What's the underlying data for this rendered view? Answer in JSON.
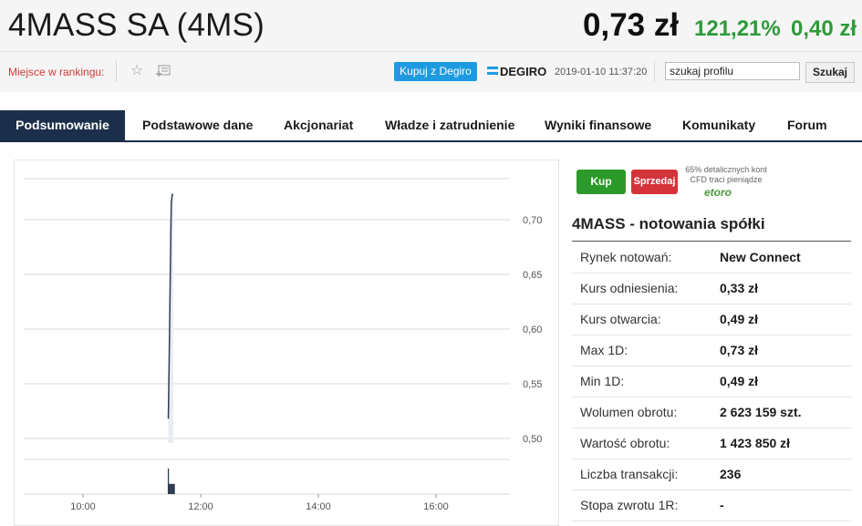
{
  "header": {
    "title": "4MASS SA (4MS)",
    "price": "0,73 zł",
    "change_pct": "121,21%",
    "change_abs": "0,40 zł",
    "rank_label": "Miejsce w rankingu:",
    "buy_degiro": "Kupuj z Degiro",
    "degiro_logo": "DEGIRO",
    "timestamp": "2019-01-10 11:37:20",
    "search_value": "szukaj profilu",
    "search_button": "Szukaj",
    "icons": [
      "star-icon",
      "add-to-list-icon",
      "degiro-logo-icon"
    ]
  },
  "tabs": [
    {
      "label": "Podsumowanie",
      "active": true
    },
    {
      "label": "Podstawowe dane"
    },
    {
      "label": "Akcjonariat"
    },
    {
      "label": "Władze i zatrudnienie"
    },
    {
      "label": "Wyniki finansowe"
    },
    {
      "label": "Komunikaty"
    },
    {
      "label": "Forum"
    }
  ],
  "chart_data": {
    "type": "line",
    "x_ticks": [
      "10:00",
      "12:00",
      "14:00",
      "16:00"
    ],
    "y_ticks": [
      "0,70",
      "0,65",
      "0,60",
      "0,55",
      "0,50"
    ],
    "ylim": [
      0.5,
      0.72
    ],
    "series": [
      {
        "values": [
          {
            "t": "11:27",
            "y": 0.518
          },
          {
            "t": "11:28",
            "y": 0.58
          },
          {
            "t": "11:29",
            "y": 0.65
          },
          {
            "t": "11:30",
            "y": 0.715
          },
          {
            "t": "11:31",
            "y": 0.723
          },
          {
            "t": "11:32",
            "y": 0.723
          }
        ]
      }
    ],
    "volume_bars": [
      {
        "t": "11:27",
        "v": 1.0
      },
      {
        "t": "11:28",
        "v": 0.4
      },
      {
        "t": "11:29",
        "v": 0.4
      },
      {
        "t": "11:30",
        "v": 0.4
      },
      {
        "t": "11:31",
        "v": 0.4
      },
      {
        "t": "11:32",
        "v": 0.4
      },
      {
        "t": "11:33",
        "v": 0.4
      }
    ],
    "colors": {
      "line": "#2f3b52",
      "area": "#e8edf3",
      "grid": "#d9d9d9",
      "volume": "#2f3b52"
    }
  },
  "trade": {
    "buy_label": "Kup",
    "sell_label": "Sprzedaj",
    "etoro_note": "65% detalicznych kont CFD traci pieniądze",
    "etoro_logo": "etoro"
  },
  "quote": {
    "title": "4MASS - notowania spółki",
    "rows": [
      {
        "label": "Rynek notowań:",
        "value": "New Connect"
      },
      {
        "label": "Kurs odniesienia:",
        "value": "0,33 zł"
      },
      {
        "label": "Kurs otwarcia:",
        "value": "0,49 zł"
      },
      {
        "label": "Max 1D:",
        "value": "0,73 zł"
      },
      {
        "label": "Min 1D:",
        "value": "0,49 zł"
      },
      {
        "label": "Wolumen obrotu:",
        "value": "2 623 159 szt."
      },
      {
        "label": "Wartość obrotu:",
        "value": "1 423 850 zł"
      },
      {
        "label": "Liczba transakcji:",
        "value": "236"
      },
      {
        "label": "Stopa zwrotu 1R:",
        "value": "-"
      }
    ]
  },
  "colors": {
    "accent": "#1c2f4a",
    "up": "#2e9a3a",
    "degiro": "#1e9be0",
    "buy": "#2b9a2b",
    "sell": "#d4333a"
  }
}
